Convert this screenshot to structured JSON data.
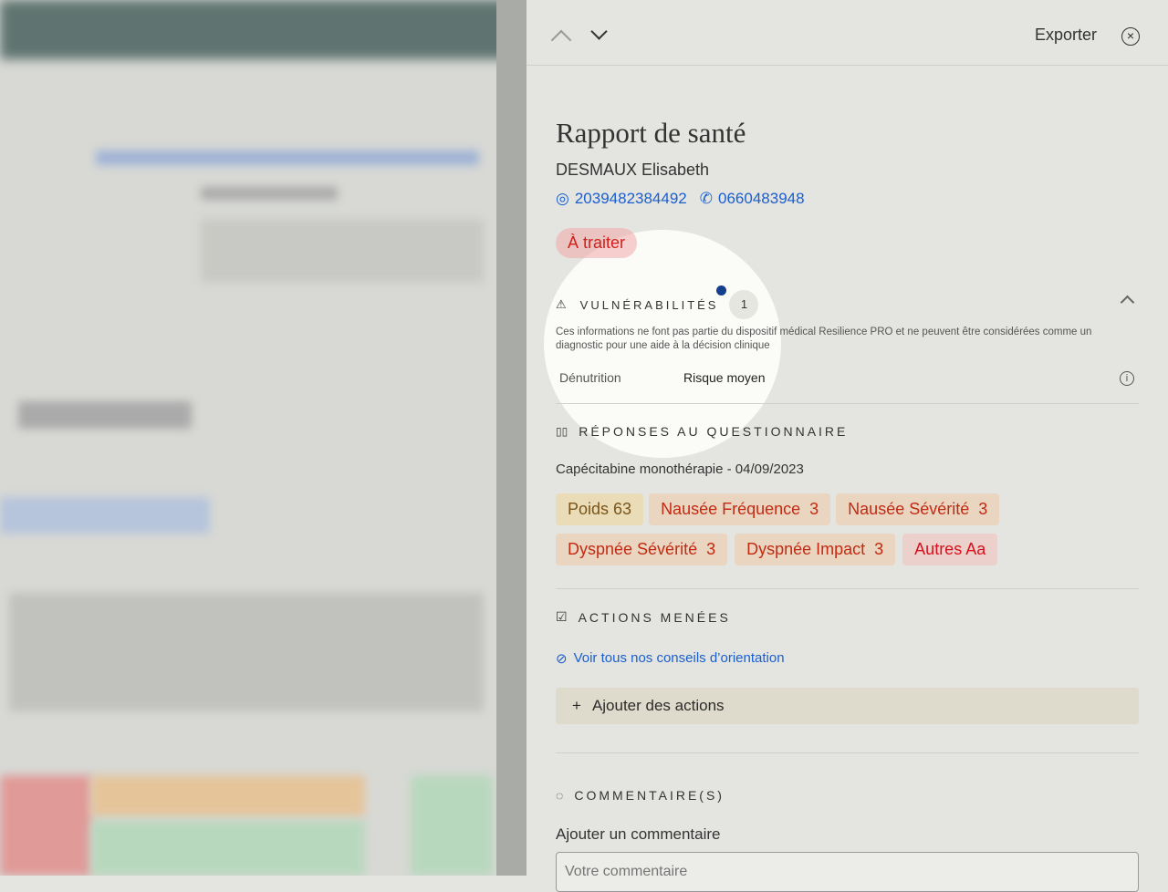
{
  "header": {
    "export_label": "Exporter"
  },
  "report": {
    "title": "Rapport de santé",
    "patient_name": "DESMAUX Elisabeth",
    "patient_id": "2039482384492",
    "phone": "0660483948",
    "status": "À traiter"
  },
  "vulnerabilities": {
    "title": "VULNÉRABILITÉS",
    "count": "1",
    "disclaimer": "Ces informations ne font pas partie du dispositif médical Resilience PRO et ne peuvent être considérées comme un diagnostic pour une aide à la décision clinique",
    "items": [
      {
        "label": "Dénutrition",
        "value": "Risque moyen"
      }
    ]
  },
  "questionnaire": {
    "title": "RÉPONSES AU QUESTIONNAIRE",
    "subtitle": "Capécitabine monothérapie - 04/09/2023",
    "chips": [
      "Poids 63",
      "Nausée Fréquence  3",
      "Nausée Sévérité  3",
      "Dyspnée Sévérité  3",
      "Dyspnée Impact  3",
      "Autres Aa"
    ]
  },
  "actions": {
    "title": "ACTIONS MENÉES",
    "link": "Voir tous nos conseils d’orientation",
    "add": "Ajouter des actions"
  },
  "comments": {
    "title": "COMMENTAIRE(S)",
    "label": "Ajouter un commentaire",
    "placeholder": "Votre commentaire"
  }
}
